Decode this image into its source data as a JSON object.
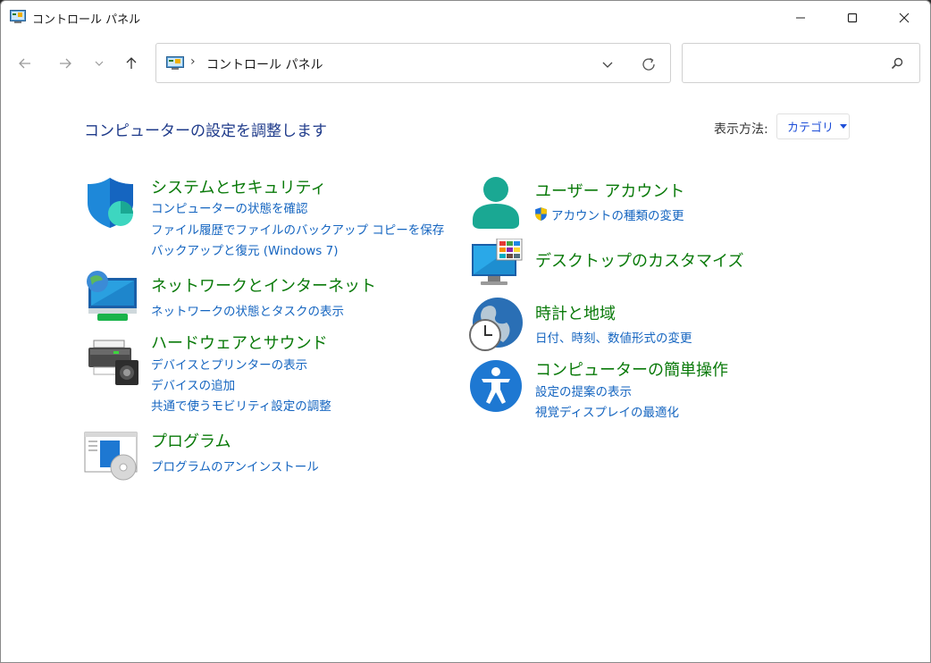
{
  "window": {
    "title": "コントロール パネル"
  },
  "address": {
    "separator": "›",
    "path": "コントロール パネル"
  },
  "search": {
    "placeholder": "",
    "value": ""
  },
  "main": {
    "heading": "コンピューターの設定を調整します",
    "view_by_label": "表示方法:",
    "view_by_value": "カテゴリ"
  },
  "categories": {
    "system_security": {
      "title": "システムとセキュリティ",
      "links": [
        "コンピューターの状態を確認",
        "ファイル履歴でファイルのバックアップ コピーを保存",
        "バックアップと復元 (Windows 7)"
      ]
    },
    "network": {
      "title": "ネットワークとインターネット",
      "links": [
        "ネットワークの状態とタスクの表示"
      ]
    },
    "hardware": {
      "title": "ハードウェアとサウンド",
      "links": [
        "デバイスとプリンターの表示",
        "デバイスの追加",
        "共通で使うモビリティ設定の調整"
      ]
    },
    "programs": {
      "title": "プログラム",
      "links": [
        "プログラムのアンインストール"
      ]
    },
    "user_accounts": {
      "title": "ユーザー アカウント",
      "links": [
        "アカウントの種類の変更"
      ]
    },
    "appearance": {
      "title": "デスクトップのカスタマイズ",
      "links": []
    },
    "clock_region": {
      "title": "時計と地域",
      "links": [
        "日付、時刻、数値形式の変更"
      ]
    },
    "ease_of_access": {
      "title": "コンピューターの簡単操作",
      "links": [
        "設定の提案の表示",
        "視覚ディスプレイの最適化"
      ]
    }
  },
  "colors": {
    "heading": "#1e3a8a",
    "category_title": "#0a7a0a",
    "link": "#1565c0"
  }
}
